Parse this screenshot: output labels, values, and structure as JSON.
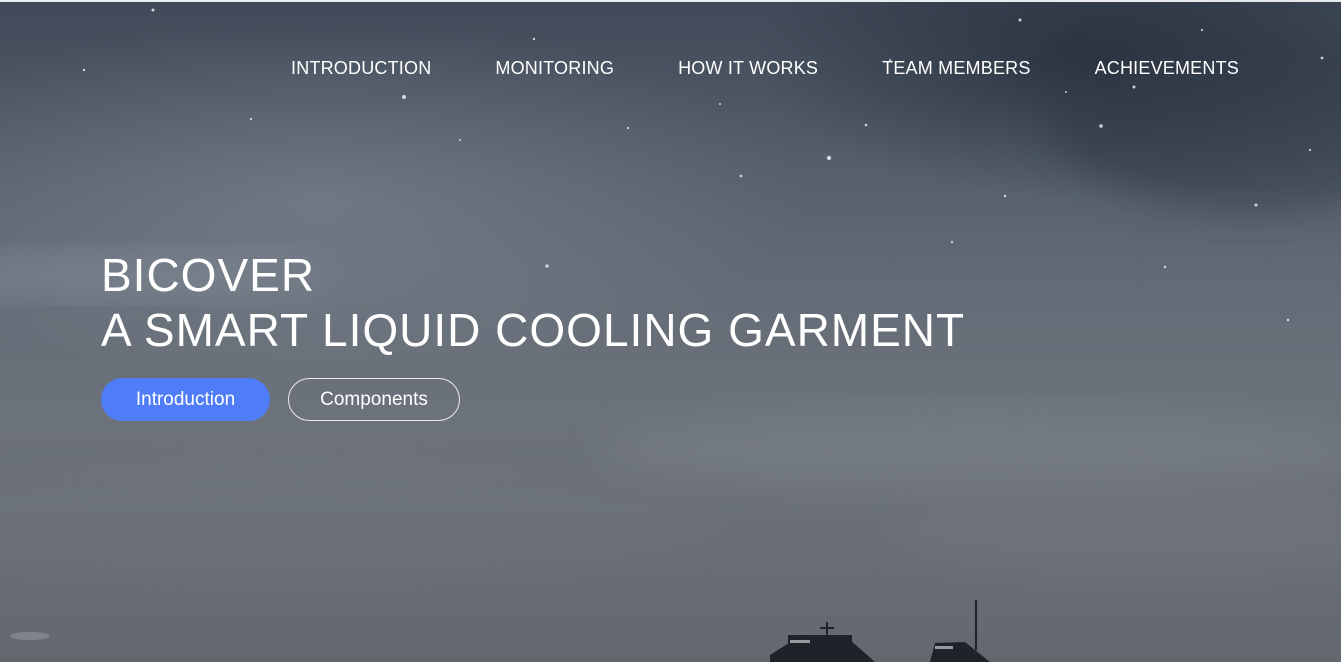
{
  "nav": {
    "items": [
      {
        "label": "INTRODUCTION"
      },
      {
        "label": "MONITORING"
      },
      {
        "label": "HOW IT WORKS"
      },
      {
        "label": "TEAM MEMBERS"
      },
      {
        "label": "ACHIEVEMENTS"
      }
    ]
  },
  "hero": {
    "title_line1": "BICOVER",
    "title_line2": "A SMART LIQUID COOLING GARMENT",
    "primary_button": "Introduction",
    "secondary_button": "Components"
  },
  "colors": {
    "accent": "#4f7df7",
    "text": "#ffffff"
  }
}
